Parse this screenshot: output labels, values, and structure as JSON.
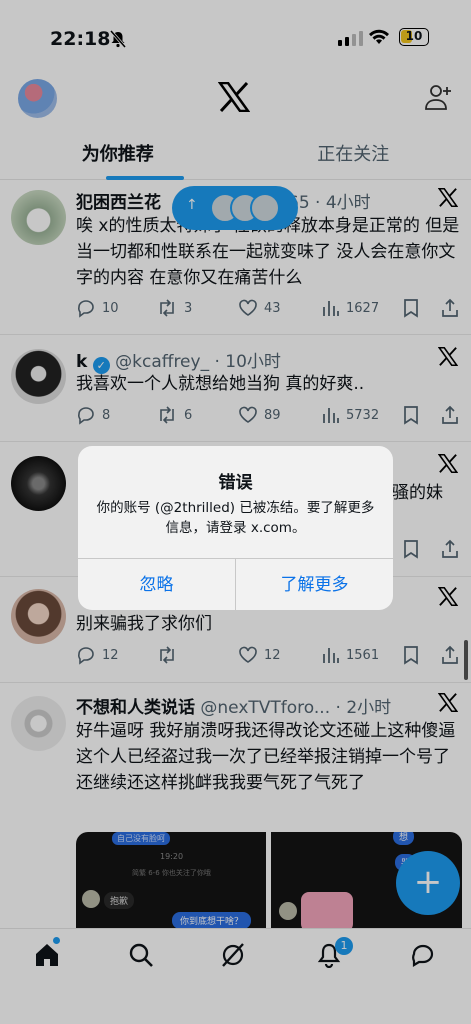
{
  "status": {
    "time": "22:18",
    "battery": "10"
  },
  "tabs": [
    "为你推荐",
    "正在关注"
  ],
  "tweets": [
    {
      "name": "犯困西兰花",
      "handle": "",
      "time": "65 · 4小时",
      "text": "唉 x的性质太特殊了 性欲的释放本身是正常的 但是当一切都和性联系在一起就变味了 没人会在意你文字的内容 在意你又在痛苦什么",
      "replies": "10",
      "retweets": "3",
      "likes": "43",
      "views": "1627"
    },
    {
      "name": "k",
      "handle": "@kcaffrey_ · 10小时",
      "time": "",
      "text": "我喜欢一个人就想给她当狗 真的好爽..",
      "replies": "8",
      "retweets": "6",
      "likes": "89",
      "views": "5732"
    },
    {
      "name": "",
      "handle": "",
      "time": "",
      "text": "骚的妹",
      "replies": "",
      "retweets": "",
      "likes": "",
      "views": ""
    },
    {
      "name": "",
      "handle": "",
      "time": "",
      "text": "别来骗我了求你们",
      "replies": "12",
      "retweets": "",
      "likes": "12",
      "views": "1561"
    },
    {
      "name": "不想和人类说话",
      "handle": "@nexTVTforo... · 2小时",
      "time": "",
      "text": "好牛逼呀 我好崩溃呀我还得改论文还碰上这种傻逼 这个人已经盗过我一次了已经举报注销掉一个号了还继续还这样挑衅我我要气死了气死了",
      "replies": "",
      "retweets": "",
      "likes": "",
      "views": ""
    }
  ],
  "images": {
    "img1_texts": [
      "自己没有脸呵",
      "19:20",
      "简繁 6-6 你也关注了你哦",
      "抱歉",
      "你到底想干啥？"
    ],
    "img2_texts": [
      "想",
      "哭"
    ]
  },
  "dialog": {
    "title": "错误",
    "message": "你的账号 (@2thrilled) 已被冻结。要了解更多信息，请登录 x.com。",
    "cancel": "忽略",
    "learn_more": "了解更多"
  },
  "notifications_badge": "1",
  "colors": {
    "accent": "#1d9bf0",
    "link": "#0a72e8"
  }
}
